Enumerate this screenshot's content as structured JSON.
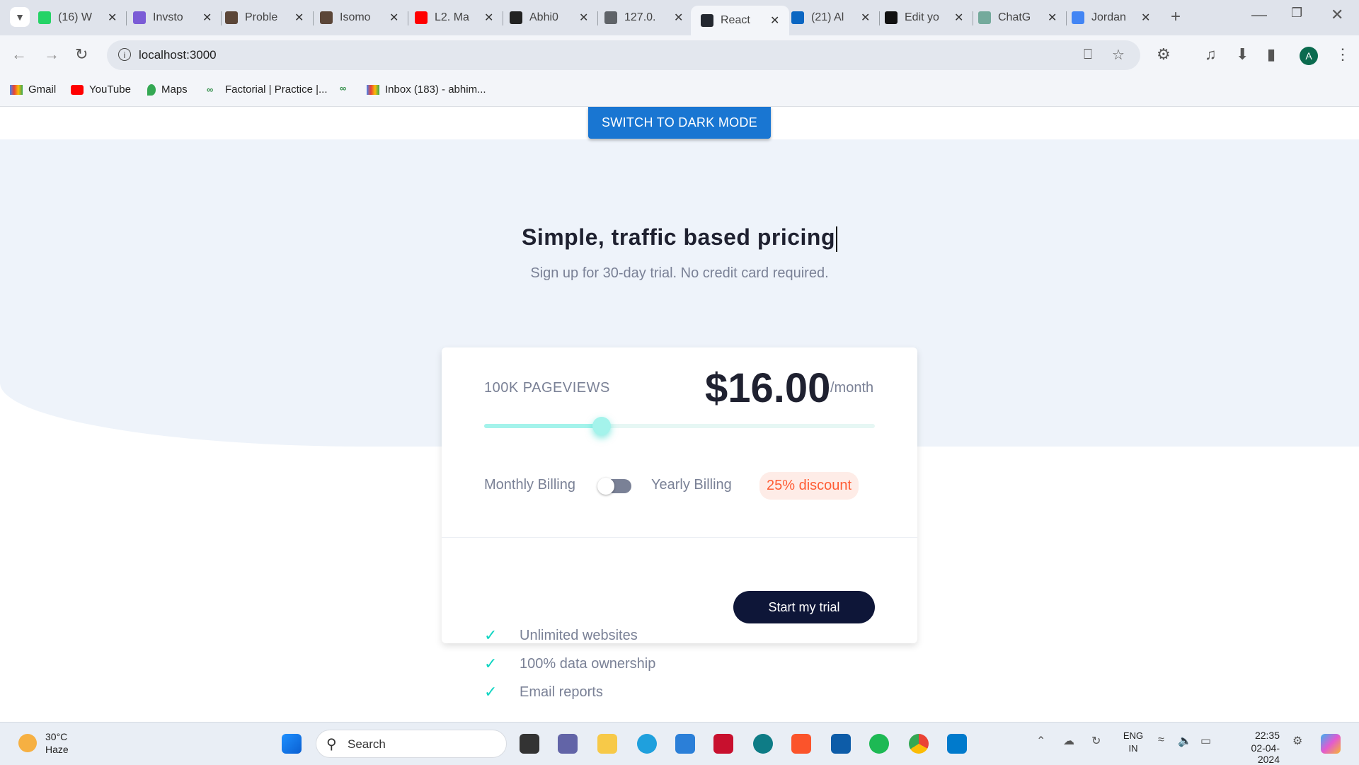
{
  "browser": {
    "tabs": [
      {
        "title": "(16) W",
        "icon": "whatsapp-icon",
        "color": "#25d366"
      },
      {
        "title": "Invsto",
        "icon": "document-icon",
        "color": "#7b5cd6"
      },
      {
        "title": "Proble",
        "icon": "codechef-icon",
        "color": "#5b4638"
      },
      {
        "title": "Isomo",
        "icon": "codechef-icon",
        "color": "#5b4638"
      },
      {
        "title": "L2. Ma",
        "icon": "youtube-icon",
        "color": "#ff0000"
      },
      {
        "title": "Abhi0",
        "icon": "github-icon",
        "color": "#222222"
      },
      {
        "title": "127.0.",
        "icon": "globe-icon",
        "color": "#5f6368"
      },
      {
        "title": "React",
        "icon": "react-icon",
        "color": "#23272f"
      },
      {
        "title": "(21) Al",
        "icon": "linkedin-icon",
        "color": "#0a66c2"
      },
      {
        "title": "Edit yo",
        "icon": "wix-icon",
        "color": "#111111"
      },
      {
        "title": "ChatG",
        "icon": "chatgpt-icon",
        "color": "#74aa9c"
      },
      {
        "title": "Jordan",
        "icon": "google-icon",
        "color": "#4285f4"
      }
    ],
    "active_tab_index": 7,
    "url": "localhost:3000",
    "bookmarks": [
      {
        "label": "Gmail",
        "icon": "gmail-icon"
      },
      {
        "label": "YouTube",
        "icon": "youtube-icon"
      },
      {
        "label": "Maps",
        "icon": "maps-icon"
      },
      {
        "label": "Factorial | Practice |...",
        "icon": "gfg-icon"
      },
      {
        "label": "",
        "icon": "gfg-icon"
      },
      {
        "label": "Inbox (183) - abhim...",
        "icon": "gmail-icon"
      }
    ],
    "profile_initial": "A"
  },
  "page": {
    "dark_mode_button": "SWITCH TO DARK MODE",
    "title": "Simple, traffic based pricing",
    "subtitle": "Sign up for 30-day trial. No credit card required.",
    "pageviews": "100K PAGEVIEWS",
    "price": "$16.00",
    "period": "/month",
    "slider_value_fraction": 0.3,
    "billing_monthly": "Monthly Billing",
    "billing_yearly": "Yearly Billing",
    "discount": "25% discount",
    "features": [
      "Unlimited websites",
      "100% data ownership",
      "Email reports"
    ],
    "cta": "Start my trial"
  },
  "taskbar": {
    "temperature": "30°C",
    "weather": "Haze",
    "search_placeholder": "Search",
    "lang_top": "ENG",
    "lang_bottom": "IN",
    "time": "22:35",
    "date": "02-04-2024"
  }
}
